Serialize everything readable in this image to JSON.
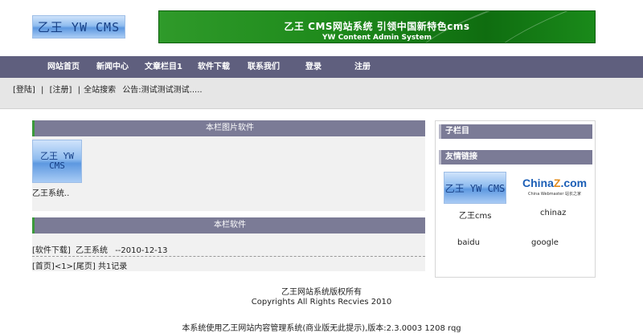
{
  "header": {
    "logo_text": "乙王 YW CMS",
    "banner": {
      "title": "乙王 CMS网站系统 引领中国新特色cms",
      "subtitle": "YW Content Admin System"
    }
  },
  "nav": {
    "items": [
      "网站首页",
      "新闻中心",
      "文章栏目1",
      "软件下载",
      "联系我们",
      "登录",
      "注册"
    ]
  },
  "userbar": {
    "login": "[登陆]",
    "sep1": "|",
    "register": "[注册]",
    "sep2": "|",
    "search": "全站搜索",
    "notice": "公告:测试测试测试....."
  },
  "left": {
    "section1": {
      "title": "本栏图片软件",
      "thumb_text": "乙王 YW CMS",
      "caption": "乙王系统.."
    },
    "section2": {
      "title": "本栏软件",
      "item_category": "[软件下载]",
      "item_title": "乙王系统",
      "item_date": "--2010-12-13",
      "pager_first": "[首页]",
      "pager_page": "<1>",
      "pager_last": "[尾页]",
      "pager_total": "共1记录"
    }
  },
  "right": {
    "subcolumn_title": "子栏目",
    "links_title": "友情链接",
    "links": [
      {
        "label": "乙王cms",
        "logo_text": "乙王 YW CMS"
      },
      {
        "label": "chinaz",
        "logo_text": "China",
        "logo_text2": "Z",
        "logo_text3": ".com",
        "logo_sub": "China Webmaster  站长之家"
      },
      {
        "label": "baidu"
      },
      {
        "label": "google"
      }
    ]
  },
  "footer": {
    "line1": "乙王网站系统版权所有",
    "line2": "Copyrights All Rights Recvies 2010",
    "line3": "本系统使用乙王网站内容管理系统(商业版无此提示),版本:2.3.0003 1208 rqg"
  }
}
